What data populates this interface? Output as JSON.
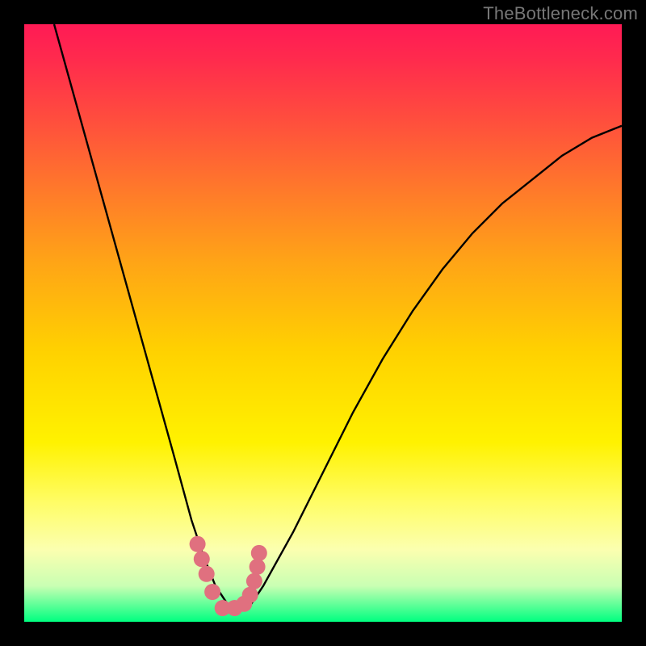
{
  "watermark": "TheBottleneck.com",
  "chart_data": {
    "type": "line",
    "title": "",
    "xlabel": "",
    "ylabel": "",
    "xlim": [
      0,
      100
    ],
    "ylim": [
      0,
      100
    ],
    "grid": false,
    "legend": false,
    "series": [
      {
        "name": "bottleneck-curve",
        "x": [
          5,
          10,
          15,
          20,
          25,
          28,
          30,
          32,
          34,
          35,
          36,
          38,
          40,
          45,
          50,
          55,
          60,
          65,
          70,
          75,
          80,
          85,
          90,
          95,
          100
        ],
        "y": [
          100,
          82,
          64,
          46,
          28,
          17,
          11,
          6,
          3,
          2,
          2,
          3,
          6,
          15,
          25,
          35,
          44,
          52,
          59,
          65,
          70,
          74,
          78,
          81,
          83
        ]
      },
      {
        "name": "highlight-points",
        "x": [
          29.0,
          29.7,
          30.5,
          31.5,
          33.2,
          35.2,
          36.8,
          37.8,
          38.5,
          39.0,
          39.3
        ],
        "y": [
          13.0,
          10.5,
          8.0,
          5.0,
          2.3,
          2.3,
          3.0,
          4.5,
          6.8,
          9.2,
          11.5
        ]
      }
    ],
    "colors": {
      "curve": "#000000",
      "highlight": "#e0707f",
      "gradient_top": "#ff1a55",
      "gradient_bottom": "#00ff80"
    }
  }
}
